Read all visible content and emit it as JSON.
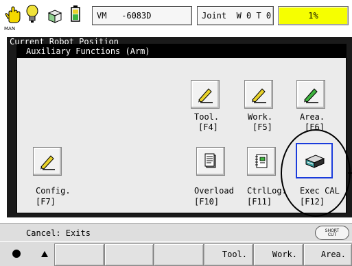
{
  "status_bar": {
    "mode_label": "MAN",
    "program_name": "VM   -6083D",
    "coord_mode": "Joint  W 0 T 0",
    "speed": "1%"
  },
  "background_window": {
    "title": "Current Robot Position"
  },
  "dialog": {
    "title": "Auxiliary Functions (Arm)",
    "buttons": [
      {
        "label": "Tool.",
        "key": "[F4]",
        "icon": "pencil-icon"
      },
      {
        "label": "Work.",
        "key": "[F5]",
        "icon": "pencil-icon"
      },
      {
        "label": "Area.",
        "key": "[F6]",
        "icon": "pencil-icon"
      },
      {
        "label": "Config.",
        "key": "[F7]",
        "icon": "pencil-icon"
      },
      {
        "label": "Overload",
        "key": "[F10]",
        "icon": "document-icon"
      },
      {
        "label": "CtrlLog.",
        "key": "[F11]",
        "icon": "notebook-icon"
      },
      {
        "label": "Exec CAL",
        "key": "[F12]",
        "icon": "calibration-device-icon"
      }
    ]
  },
  "message_bar": {
    "text": "Cancel: Exits",
    "shortcut_label_top": "SHORT",
    "shortcut_label_bottom": "CUT"
  },
  "function_keys": [
    "",
    "",
    "",
    "",
    "",
    "Tool.",
    "Work.",
    "Area."
  ],
  "colors": {
    "speed_bg": "#f6ff00",
    "selection_border": "#1a3cdc",
    "window_bg": "#1a1a1a",
    "pencil_body": "#e8d22a",
    "pencil_tip_area": "#3fb33f"
  }
}
